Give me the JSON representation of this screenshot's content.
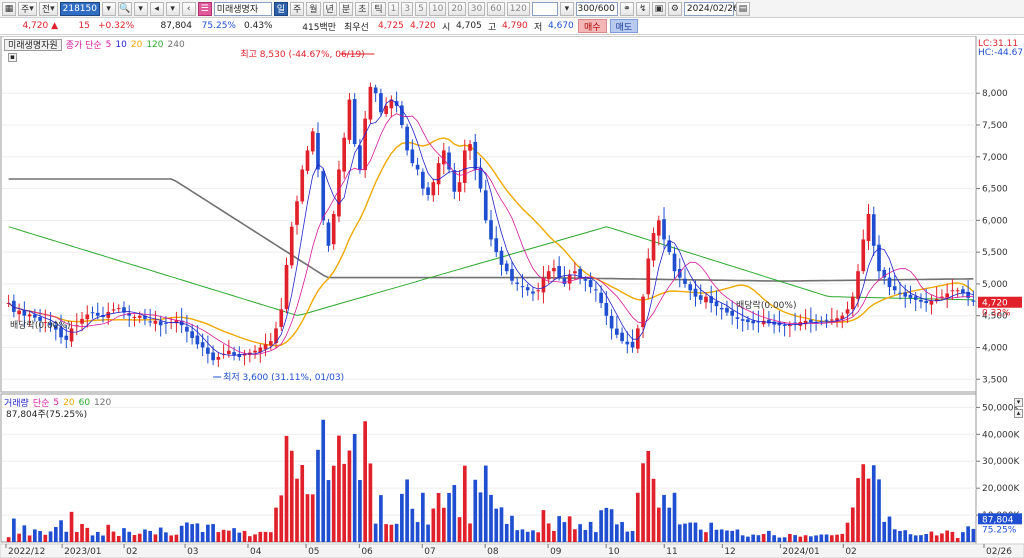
{
  "toolbar": {
    "market_select": "주",
    "type_select": "전",
    "stock_code": "218150",
    "stock_name": "미래생명자",
    "period_buttons": [
      "일",
      "주",
      "월",
      "년",
      "분",
      "초",
      "틱"
    ],
    "interval_buttons": [
      "1",
      "3",
      "5",
      "10",
      "20",
      "30",
      "60",
      "120"
    ],
    "count_value": "300/600",
    "date_value": "2024/02/26"
  },
  "quote": {
    "price": "4,720",
    "change": "15",
    "change_pct": "+0.32%",
    "volume": "87,804",
    "volume_ratio": "75.25%",
    "turnover": "0.43%",
    "amount": "415백만",
    "best_bid_label": "최우선",
    "best_bid": "4,725",
    "best_ask": "4,720",
    "open_label": "시",
    "open": "4,705",
    "high_label": "고",
    "high": "4,790",
    "low_label": "저",
    "low": "4,670",
    "buy_label": "매수",
    "sell_label": "매도"
  },
  "colors": {
    "up": "#e0202a",
    "down": "#1f4fd0",
    "ma5": "#2222cc",
    "ma10": "#d8189a",
    "ma20": "#f0a800",
    "ma60": "#2da82d",
    "ma120": "#707070"
  },
  "chart_data": [
    {
      "type": "candlestick",
      "legend": {
        "name": "미래생명자원",
        "indicator": "종가 단순",
        "periods": [
          "5",
          "10",
          "20",
          "120",
          "240"
        ]
      },
      "ylim": [
        3300,
        8900
      ],
      "y_ticks": [
        3500,
        4000,
        4500,
        5000,
        5500,
        6000,
        6500,
        7000,
        7500,
        8000
      ],
      "y_tick_labels": [
        "3,500",
        "4,000",
        "4,500",
        "5,000",
        "5,500",
        "6,000",
        "6,500",
        "7,000",
        "7,500",
        "8,000"
      ],
      "x_labels": [
        "2022/12",
        "2023/01",
        "02",
        "03",
        "04",
        "05",
        "06",
        "07",
        "08",
        "09",
        "10",
        "11",
        "12",
        "2024/01",
        "02",
        "02/26"
      ],
      "right_top_labels": [
        "LC:31.11",
        "HC:-44.67"
      ],
      "last_price_label": "4,720",
      "last_change_label": "0.32%",
      "annotations": [
        {
          "text": "최고 8,530 (-44.67%, 06/19)",
          "value": 8530
        },
        {
          "text": "최저 3,600 (31.11%, 01/03)",
          "value": 3600
        },
        {
          "text": "배당락(0.00%)"
        },
        {
          "text": "배당락(0.00%)"
        }
      ],
      "close": [
        4700,
        4560,
        4580,
        4500,
        4520,
        4470,
        4420,
        4400,
        4350,
        4280,
        4160,
        4120,
        4300,
        4350,
        4450,
        4520,
        4550,
        4500,
        4480,
        4560,
        4600,
        4620,
        4550,
        4500,
        4480,
        4500,
        4450,
        4400,
        4420,
        4350,
        4380,
        4400,
        4430,
        4350,
        4250,
        4150,
        4050,
        4000,
        3900,
        3800,
        3850,
        3900,
        3950,
        3880,
        3850,
        3900,
        3920,
        3950,
        4000,
        4050,
        4100,
        4300,
        4600,
        5300,
        5900,
        6300,
        6800,
        7100,
        7400,
        6800,
        6000,
        5600,
        6100,
        6800,
        7300,
        7900,
        7200,
        6800,
        7600,
        8100,
        8000,
        7700,
        7800,
        7900,
        7800,
        7500,
        7100,
        6900,
        6800,
        6500,
        6400,
        6600,
        6900,
        7100,
        6800,
        6450,
        6600,
        7100,
        7200,
        6800,
        6500,
        6000,
        5700,
        5500,
        5300,
        5200,
        5050,
        5000,
        4950,
        4900,
        4850,
        4900,
        5100,
        5200,
        5250,
        5100,
        5000,
        5150,
        5200,
        5100,
        5050,
        4950,
        4900,
        4700,
        4500,
        4300,
        4200,
        4100,
        4050,
        4000,
        4300,
        4800,
        5400,
        5800,
        6000,
        5700,
        5500,
        5200,
        5100,
        5000,
        4900,
        4800,
        4750,
        4800,
        4700,
        4650,
        4600,
        4550,
        4500,
        4450,
        4420,
        4400,
        4380,
        4400,
        4420,
        4380,
        4360,
        4350,
        4340,
        4360,
        4380,
        4400,
        4420,
        4400,
        4380,
        4400,
        4420,
        4440,
        4460,
        4500,
        4600,
        4800,
        5200,
        5700,
        6100,
        5600,
        5200,
        5100,
        4950,
        4900,
        4850,
        4800,
        4780,
        4750,
        4720,
        4700,
        4740,
        4760,
        4800,
        4850,
        4900,
        4900,
        4850,
        4780,
        4720
      ],
      "volume_panel": {
        "legend": {
          "name": "거래량",
          "indicator": "단순",
          "periods": [
            "5",
            "20",
            "60",
            "120"
          ]
        },
        "current_label": "87,804주(75.25%)",
        "ylim": [
          0,
          52000
        ],
        "y_ticks": [
          10000,
          20000,
          30000,
          40000,
          50000
        ],
        "y_tick_labels": [
          "10,000K",
          "20,000K",
          "30,000K",
          "40,000K",
          "50,000K"
        ],
        "last_volume_label": "87,804",
        "last_ratio_label": "75.25%"
      }
    }
  ]
}
